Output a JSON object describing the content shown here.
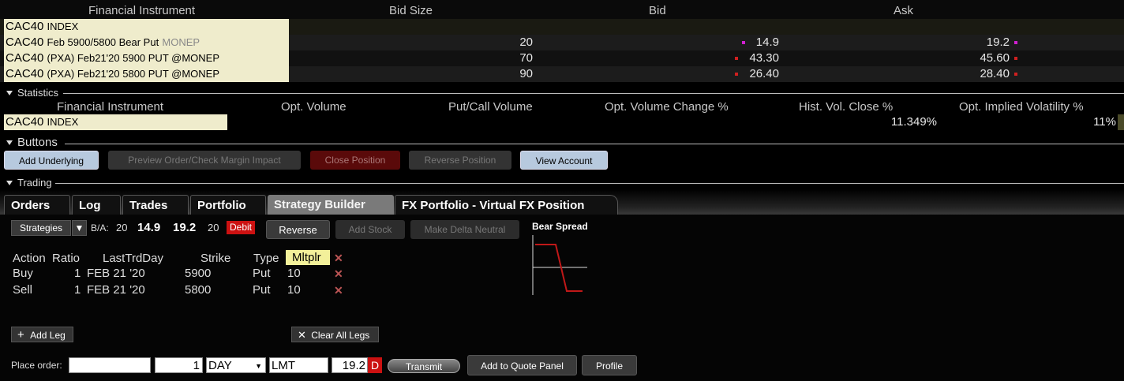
{
  "quote": {
    "headers": [
      "Financial Instrument",
      "Bid Size",
      "Bid",
      "Ask"
    ],
    "rows": [
      {
        "symbol": "CAC40",
        "detail": "INDEX",
        "exchange": "",
        "bid_size": "",
        "bid": "",
        "ask": ""
      },
      {
        "symbol": "CAC40",
        "detail": "Feb 5900/5800 Bear Put",
        "exchange": "MONEP",
        "bid_size": "20",
        "bid": "14.9",
        "ask": "19.2"
      },
      {
        "symbol": "CAC40",
        "detail": "(PXA) Feb21'20 5900 PUT @MONEP",
        "exchange": "",
        "bid_size": "70",
        "bid": "43.30",
        "ask": "45.60"
      },
      {
        "symbol": "CAC40",
        "detail": "(PXA) Feb21'20 5800 PUT @MONEP",
        "exchange": "",
        "bid_size": "90",
        "bid": "26.40",
        "ask": "28.40"
      }
    ],
    "marker_colors": {
      "magenta": "#d020d0",
      "red": "#d02020"
    }
  },
  "statistics": {
    "title": "Statistics",
    "headers": [
      "Financial Instrument",
      "Opt. Volume",
      "Put/Call Volume",
      "Opt. Volume Change %",
      "Hist. Vol. Close %",
      "Opt. Implied Volatility %"
    ],
    "row": {
      "symbol": "CAC40",
      "detail": "INDEX",
      "hist_vol": "11.349%",
      "implied_vol": "11%"
    }
  },
  "buttons_section": {
    "title": "Buttons",
    "buttons": [
      "Add Underlying",
      "Preview Order/Check Margin Impact",
      "Close Position",
      "Reverse Position",
      "View Account"
    ]
  },
  "trading": {
    "title": "Trading",
    "tabs": [
      "Orders",
      "Log",
      "Trades",
      "Portfolio",
      "Strategy Builder",
      "FX Portfolio - Virtual FX Position"
    ],
    "active_tab": "Strategy Builder",
    "strategy_bar": {
      "strategies_label": "Strategies",
      "dropdown_arrow": "▼",
      "ba_label": "B/A:",
      "bid_size": "20",
      "bid": "14.9",
      "ask": "19.2",
      "ask_size": "20",
      "debit_badge": "Debit",
      "reverse_btn": "Reverse",
      "add_stock_btn": "Add Stock",
      "delta_neutral_btn": "Make Delta Neutral"
    },
    "chart_title": "Bear Spread",
    "legs_headers": [
      "Action",
      "Ratio",
      "LastTrdDay",
      "Strike",
      "Type",
      "Mltplr"
    ],
    "legs": [
      {
        "action": "Buy",
        "ratio": "1",
        "last_day": "FEB 21 '20",
        "strike": "5900",
        "type": "Put",
        "mult": "10"
      },
      {
        "action": "Sell",
        "ratio": "1",
        "last_day": "FEB 21 '20",
        "strike": "5800",
        "type": "Put",
        "mult": "10"
      }
    ],
    "add_leg": "Add Leg",
    "clear_legs": "Clear All Legs",
    "place_order": {
      "label": "Place order:",
      "account": "",
      "quantity": "1",
      "tif": "DAY",
      "order_type": "LMT",
      "price": "19.2",
      "price_flag": "D",
      "transmit": "Transmit",
      "add_quote": "Add to Quote Panel",
      "profile": "Profile"
    }
  },
  "colors": {
    "instrument_bg": "#efeccc",
    "debit": "#cc1111",
    "mltplr_bg": "#f3f09a",
    "button_blue": "#b7c9de",
    "button_red": "#5a0a0a"
  }
}
